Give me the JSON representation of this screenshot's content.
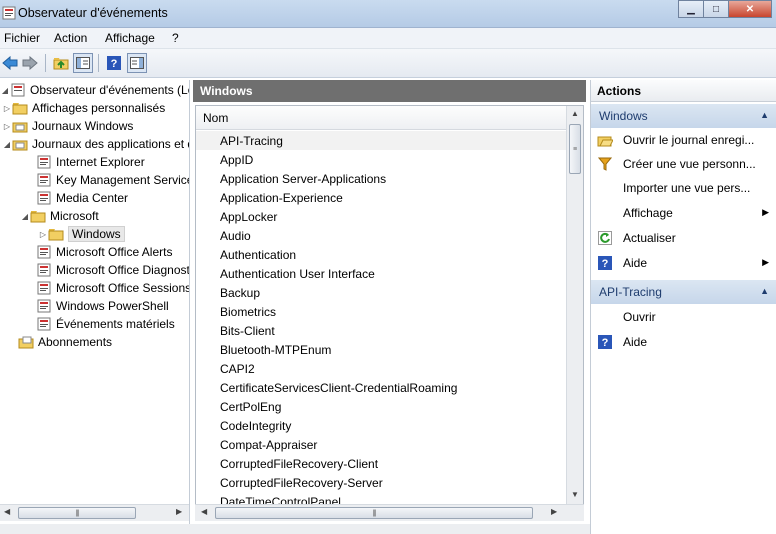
{
  "window": {
    "title": "Observateur d'événements",
    "minimize": "▁",
    "maximize": "□",
    "close": "✕"
  },
  "menu": [
    "Fichier",
    "Action",
    "Affichage",
    "?"
  ],
  "toolbar": {
    "icons": [
      "back-arrow-icon",
      "forward-arrow-icon",
      "up-folder-icon",
      "show-hide-tree-icon",
      "help-icon",
      "show-hide-action-pane-icon"
    ]
  },
  "tree": {
    "root": "Observateur d'événements (Local)",
    "items": [
      {
        "label": "Affichages personnalisés"
      },
      {
        "label": "Journaux Windows"
      },
      {
        "label": "Journaux des applications et de services"
      },
      {
        "label": "Internet Explorer"
      },
      {
        "label": "Key Management Service"
      },
      {
        "label": "Media Center"
      },
      {
        "label": "Microsoft"
      },
      {
        "label": "Windows"
      },
      {
        "label": "Microsoft Office Alerts"
      },
      {
        "label": "Microsoft Office Diagnostics"
      },
      {
        "label": "Microsoft Office Sessions"
      },
      {
        "label": "Windows PowerShell"
      },
      {
        "label": "Événements matériels"
      },
      {
        "label": "Abonnements"
      }
    ]
  },
  "middle": {
    "header": "Windows",
    "column": "Nom",
    "rows": [
      "API-Tracing",
      "AppID",
      "Application Server-Applications",
      "Application-Experience",
      "AppLocker",
      "Audio",
      "Authentication",
      "Authentication User Interface",
      "Backup",
      "Biometrics",
      "Bits-Client",
      "Bluetooth-MTPEnum",
      "CAPI2",
      "CertificateServicesClient-CredentialRoaming",
      "CertPolEng",
      "CodeIntegrity",
      "Compat-Appraiser",
      "CorruptedFileRecovery-Client",
      "CorruptedFileRecovery-Server",
      "DateTimeControlPanel"
    ]
  },
  "actions": {
    "title": "Actions",
    "section1": {
      "header": "Windows",
      "items": [
        {
          "label": "Ouvrir le journal enregi...",
          "icon": "open-folder-icon"
        },
        {
          "label": "Créer une vue personn...",
          "icon": "filter-icon"
        },
        {
          "label": "Importer une vue pers...",
          "icon": ""
        },
        {
          "label": "Affichage",
          "icon": "",
          "submenu": "▶"
        },
        {
          "label": "Actualiser",
          "icon": "refresh-icon"
        },
        {
          "label": "Aide",
          "icon": "help-icon",
          "submenu": "▶"
        }
      ]
    },
    "section2": {
      "header": "API-Tracing",
      "items": [
        {
          "label": "Ouvrir",
          "icon": ""
        },
        {
          "label": "Aide",
          "icon": "help-icon"
        }
      ]
    }
  },
  "colors": {
    "accent": "#c6d6ea",
    "header_dark": "#6f6f6f",
    "help_blue": "#2a56b8"
  }
}
